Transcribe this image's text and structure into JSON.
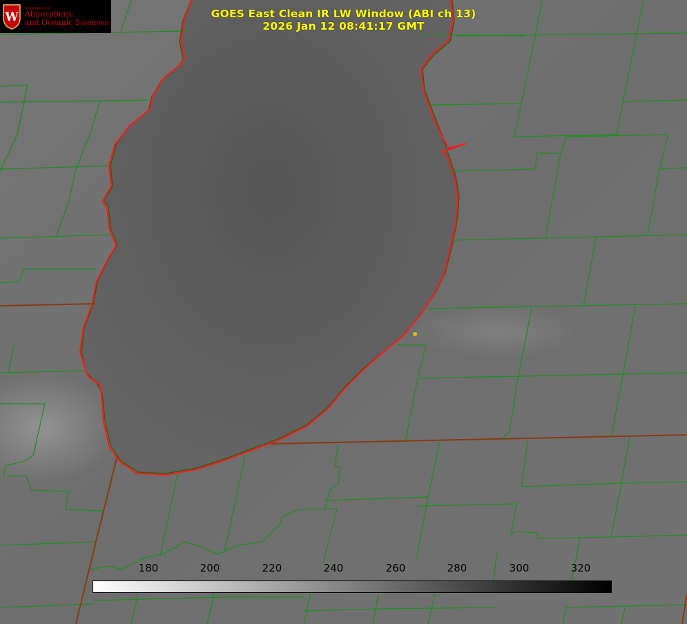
{
  "title": {
    "line1": "GOES East Clean IR LW Window (ABI ch 13)",
    "line2": "2026 Jan 12 08:41:17 GMT"
  },
  "logo": {
    "department": "Department of",
    "line1": "Atmospheric",
    "line2": "and Oceanic Sciences",
    "mark": "W"
  },
  "colorbar": {
    "ticks": [
      "180",
      "200",
      "220",
      "240",
      "260",
      "280",
      "300",
      "320"
    ],
    "gradient_start": "#ffffff",
    "gradient_end": "#000000"
  },
  "colors": {
    "background": "#6f6f6f",
    "lake": "#5a5a5a",
    "county_lines": "#1f8f1f",
    "shoreline": "#ff1a1a",
    "state_lines": "#8a3a10",
    "title_text": "#ffff00",
    "marker": "#d4c21a"
  }
}
